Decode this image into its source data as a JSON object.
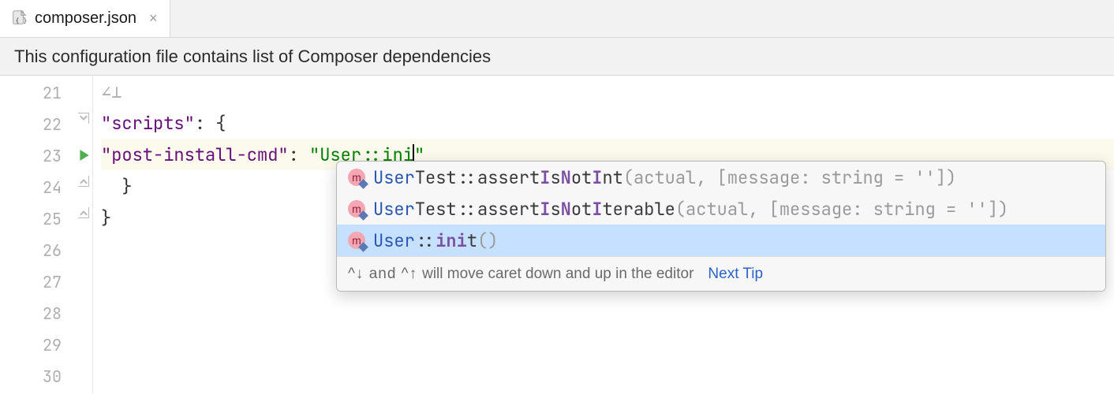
{
  "tab": {
    "filename": "composer.json",
    "icon": "json-file-icon",
    "close_label": "×"
  },
  "banner": {
    "text": "This configuration file contains list of Composer dependencies"
  },
  "editor": {
    "lines": [
      {
        "num": "21"
      },
      {
        "num": "22"
      },
      {
        "num": "23"
      },
      {
        "num": "24"
      },
      {
        "num": "25"
      },
      {
        "num": "26"
      },
      {
        "num": "27"
      },
      {
        "num": "28"
      },
      {
        "num": "29"
      },
      {
        "num": "30"
      }
    ],
    "line22_key": "\"scripts\"",
    "line22_after": ": {",
    "line23_key": "\"post-install-cmd\"",
    "line23_sep": ": ",
    "line23_str_open": "\"",
    "line23_str_body": "User::ini",
    "line23_str_close": "\"",
    "line24_text": "  }",
    "line25_text": "}"
  },
  "completion": {
    "items": [
      {
        "cls_pre": "User",
        "cls_rest": "Test",
        "sep": "::",
        "method_plain1": "assert",
        "method_match1": "I",
        "method_plain2": "s",
        "method_match2": "N",
        "method_plain3": "ot",
        "method_match3": "I",
        "method_plain4": "nt",
        "params": "(actual, [message: string = ''])",
        "selected": false
      },
      {
        "cls_pre": "User",
        "cls_rest": "Test",
        "sep": "::",
        "method_plain1": "assert",
        "method_match1": "I",
        "method_plain2": "s",
        "method_match2": "N",
        "method_plain3": "ot",
        "method_match3": "I",
        "method_plain4": "terable",
        "params": "(actual, [message: string = ''])",
        "selected": false
      },
      {
        "cls_pre": "User",
        "cls_rest": "",
        "sep": "::",
        "method_match_full": "ini",
        "method_plain_tail": "t",
        "params": "()",
        "selected": true
      }
    ],
    "hint_prefix": "^↓ and ^↑",
    "hint_text": " will move caret down and up in the editor",
    "next_tip": "Next Tip"
  }
}
